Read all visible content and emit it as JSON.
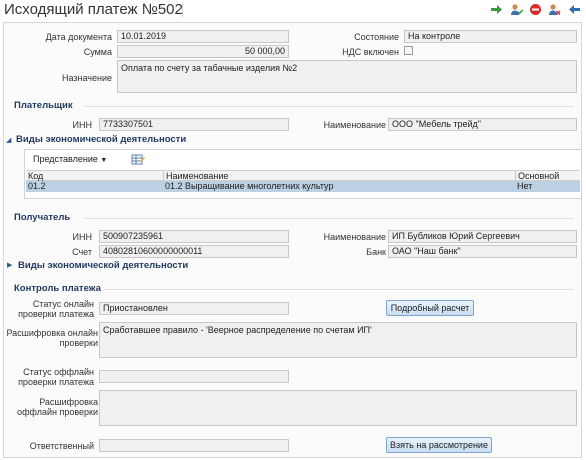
{
  "window": {
    "title": "Исходящий платеж №502"
  },
  "toolbar": {
    "icons": [
      "arrow-right-icon",
      "user-check-icon",
      "stop-icon",
      "user-remove-icon",
      "arrow-left-icon"
    ]
  },
  "document": {
    "date_label": "Дата документа",
    "date_value": "10.01.2019",
    "sum_label": "Сумма",
    "sum_value": "50 000,00",
    "state_label": "Состояние",
    "state_value": "На контроле",
    "vat_label": "НДС включен",
    "vat_checked": false,
    "purpose_label": "Назначение",
    "purpose_value": "Оплата по счету за табачные изделия №2"
  },
  "payer": {
    "section_title": "Плательщик",
    "inn_label": "ИНН",
    "inn_value": "7733307501",
    "name_label": "Наименование",
    "name_value": "ООО \"Мебель трейд\"",
    "activities_title": "Виды экономической деятельности",
    "view_button": "Представление",
    "columns": [
      "Код",
      "Наименование",
      "Основной"
    ],
    "rows": [
      {
        "code": "01.2",
        "name": "01.2 Выращивание многолетних культур",
        "main": "Нет"
      }
    ]
  },
  "recipient": {
    "section_title": "Получатель",
    "inn_label": "ИНН",
    "inn_value": "500907235961",
    "account_label": "Счет",
    "account_value": "40802810600000000011",
    "name_label": "Наименование",
    "name_value": "ИП Бубликов Юрий Сергеевич",
    "bank_label": "Банк",
    "bank_value": "ОАО \"Наш банк\"",
    "activities_title": "Виды экономической деятельности"
  },
  "control": {
    "section_title": "Контроль платежа",
    "online_status_label_1": "Статус онлайн",
    "online_status_label_2": "проверки платежа",
    "online_status_value": "Приостановлен",
    "detail_button": "Подробный расчет",
    "online_decode_label_1": "Расшифровка онлайн",
    "online_decode_label_2": "проверки",
    "online_decode_value": "Сработавшее правило - 'Веерное распределение по счетам ИП'",
    "offline_status_label_1": "Статус оффлайн",
    "offline_status_label_2": "проверки платежа",
    "offline_status_value": "",
    "offline_decode_label_1": "Расшифровка",
    "offline_decode_label_2": "оффлайн проверки",
    "offline_decode_value": "",
    "responsible_label": "Ответственный",
    "responsible_value": "",
    "take_button": "Взять на рассмотрение"
  },
  "colors": {
    "section_title": "#1f3a5f",
    "selected_row": "#bcd0e4",
    "button_border": "#7fa6cc"
  }
}
